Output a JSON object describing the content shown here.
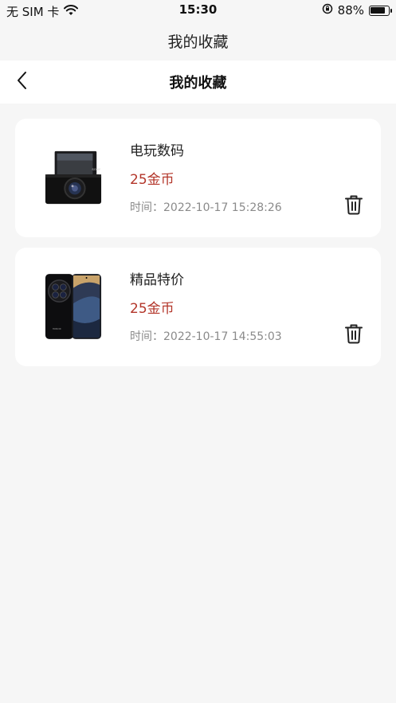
{
  "status": {
    "carrier": "无 SIM 卡",
    "time": "15:30",
    "battery_percent": "88%",
    "battery_level": 0.88,
    "icons": [
      "wifi-icon",
      "orientation-lock-icon",
      "battery-icon"
    ]
  },
  "app_title": "我的收藏",
  "nav": {
    "title": "我的收藏",
    "back_icon": "chevron-left-icon"
  },
  "favorites": [
    {
      "title": "电玩数码",
      "price": "25金币",
      "time": "时间：2022-10-17 15:28:26",
      "image": "camera"
    },
    {
      "title": "精品特价",
      "price": "25金币",
      "time": "时间：2022-10-17 14:55:03",
      "image": "smartphone"
    }
  ],
  "colors": {
    "price": "#b3362a",
    "background": "#f6f6f6",
    "card": "#ffffff"
  }
}
